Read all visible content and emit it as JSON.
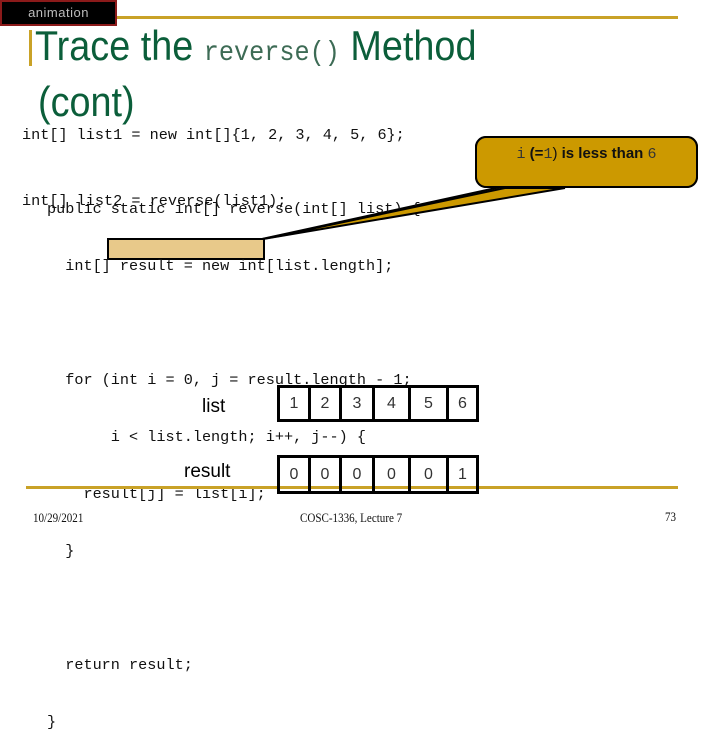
{
  "slide": {
    "animation_tag": "animation",
    "title": {
      "prefix": "Trace the ",
      "code": "reverse()",
      "suffix": " Method",
      "line2": "(cont)"
    },
    "top_code": [
      "int[] list1 = new int[]{1, 2, 3, 4, 5, 6};",
      "int[] list2 = reverse(list1);"
    ],
    "method_code": [
      "public static int[] reverse(int[] list) {",
      "  int[] result = new int[list.length];",
      "",
      "  for (int i = 0, j = result.length - 1;",
      "       i < list.length; i++, j--) {",
      "    result[j] = list[i];",
      "  }",
      "",
      "  return result;",
      "}"
    ],
    "highlight_text": "i < list.length",
    "callout": {
      "var": "i",
      "open": " (=",
      "value": "1",
      "close": ")",
      "middle": " is less than ",
      "limit": "6"
    },
    "arrays": {
      "list": {
        "label": "list",
        "values": [
          "1",
          "2",
          "3",
          "4",
          "5",
          "6"
        ]
      },
      "result": {
        "label": "result",
        "values": [
          "0",
          "0",
          "0",
          "0",
          "0",
          "1"
        ]
      }
    },
    "footer": {
      "date": "10/29/2021",
      "course": "COSC-1336, Lecture 7",
      "page": "73"
    },
    "colors": {
      "accent_gold": "#c9a227",
      "title_green": "#0b5e3a",
      "callout_fill": "#cc9900",
      "highlight_fill": "#e8c98a"
    }
  }
}
